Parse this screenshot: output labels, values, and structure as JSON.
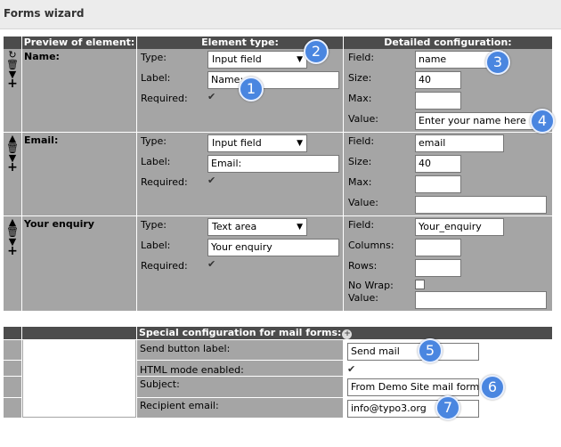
{
  "window": {
    "title": "Forms wizard"
  },
  "headers": {
    "preview": "Preview of element:",
    "type": "Element type:",
    "config": "Detailed configuration:"
  },
  "labels": {
    "type": "Type:",
    "label": "Label:",
    "required": "Required:",
    "field": "Field:",
    "size": "Size:",
    "max": "Max:",
    "value": "Value:",
    "columns": "Columns:",
    "rows": "Rows:",
    "nowrap": "No Wrap:"
  },
  "rows": [
    {
      "preview": "Name:",
      "type": "Input field",
      "label": "Name:",
      "field": "name",
      "size": "40",
      "max": "",
      "value": "Enter your name here"
    },
    {
      "preview": "Email:",
      "type": "Input field",
      "label": "Email:",
      "field": "email",
      "size": "40",
      "max": "",
      "value": ""
    },
    {
      "preview": "Your enquiry",
      "type": "Text area",
      "label": "Your enquiry",
      "field": "Your_enquiry",
      "columns": "",
      "rows": "",
      "value": ""
    }
  ],
  "mail": {
    "header": "Special configuration for mail forms:",
    "send_label": "Send button label:",
    "send_value": "Send mail",
    "html_label": "HTML mode enabled:",
    "subject_label": "Subject:",
    "subject_value": "From Demo Site mail form",
    "recipient_label": "Recipient email:",
    "recipient_value": "info@typo3.org"
  },
  "badges": [
    "1",
    "2",
    "3",
    "4",
    "5",
    "6",
    "7"
  ],
  "colors": {
    "badge": "#4a86e0",
    "header_bg": "#4c4c4c",
    "cell_bg": "#a5a5a5"
  },
  "icons": [
    "move-up-icon",
    "delete-icon",
    "move-down-icon",
    "add-icon",
    "help-icon",
    "checkbox-checked-icon"
  ]
}
